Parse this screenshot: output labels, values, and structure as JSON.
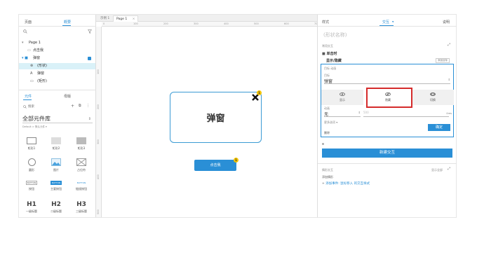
{
  "left": {
    "tabs": [
      "页面",
      "概要"
    ],
    "active_tab": "概要",
    "outline": [
      {
        "label": "Page 1"
      },
      {
        "label": "点击我"
      },
      {
        "label": "弹窗"
      },
      {
        "label": "(形状)"
      },
      {
        "label": "弹窗"
      },
      {
        "label": "(矩形)"
      }
    ],
    "lib_tabs": [
      "元件",
      "母版"
    ],
    "lib_search_placeholder": "搜索",
    "lib_select": "全部元件库",
    "lib_sub": "Default > 默认元件 ▾",
    "widgets": [
      {
        "label": "矩形1",
        "icon": "rect"
      },
      {
        "label": "矩形2",
        "icon": "rect-gray"
      },
      {
        "label": "矩形3",
        "icon": "rect-dark"
      },
      {
        "label": "圆形",
        "icon": "circle"
      },
      {
        "label": "图片",
        "icon": "image"
      },
      {
        "label": "占位符",
        "icon": "placeholder"
      },
      {
        "label": "按钮",
        "icon": "button"
      },
      {
        "label": "主要按钮",
        "icon": "button-primary"
      },
      {
        "label": "链接按钮",
        "icon": "button-link"
      },
      {
        "label": "一级标题",
        "icon": "H1"
      },
      {
        "label": "二级标题",
        "icon": "H2"
      },
      {
        "label": "三级标题",
        "icon": "H3"
      }
    ],
    "widget_small": [
      "BUTTON",
      "BUTTON",
      "BUTTON"
    ]
  },
  "canvas": {
    "doc_tabs": [
      "示例 1",
      "Page 1"
    ],
    "ruler_h": [
      "0",
      "100",
      "200",
      "300",
      "400",
      "500",
      "600",
      "700",
      "800",
      "900"
    ],
    "ruler_v": [
      "100",
      "200",
      "300",
      "400",
      "500"
    ],
    "popup_title": "弹窗",
    "popup_badge": "1",
    "button_label": "点击我",
    "button_badge": "1"
  },
  "right": {
    "tabs": [
      "样式",
      "交互",
      "说明"
    ],
    "active_tab": "交互",
    "shape_name_placeholder": "(形状名称)",
    "section_label": "常用交互",
    "event": "单击时",
    "action": "显示/隐藏",
    "action_tag": "添加目标",
    "cfg_header": "目标 动画",
    "target_label": "目标",
    "target_value": "弹窗",
    "anim_options": [
      {
        "label": "显示",
        "icon": "eye"
      },
      {
        "label": "隐藏",
        "icon": "eye-off"
      },
      {
        "label": "切换",
        "icon": "eye-toggle"
      }
    ],
    "anim_selected": "隐藏",
    "anim_label": "动画",
    "anim_value": "无",
    "anim_time": "500",
    "more_options": "更多选项 ▾",
    "delete_label": "删除",
    "ok_label": "确定",
    "new_interaction": "新建交互",
    "cases_label": "情形交互",
    "cases_action": "显示全部",
    "cases_note": "添加情形",
    "add_link": "添加事件: 鼠标移入 的交互样式"
  },
  "colors": {
    "accent": "#2a8fd6",
    "highlight": "#d52b2b",
    "badge": "#f2c300",
    "selected_row": "#d9f1f8"
  }
}
